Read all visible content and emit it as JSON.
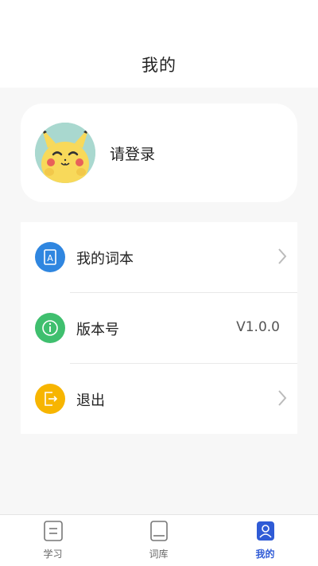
{
  "header": {
    "title": "我的"
  },
  "profile": {
    "login_label": "请登录",
    "avatar_icon": "pikachu-avatar"
  },
  "menu": {
    "items": [
      {
        "label": "我的词本",
        "icon": "vocabulary-book-icon",
        "icon_color": "#2f86e0"
      },
      {
        "label": "版本号",
        "value": "V1.0.0",
        "icon": "info-icon",
        "icon_color": "#3fbf6e"
      },
      {
        "label": "退出",
        "icon": "logout-icon",
        "icon_color": "#f7b500"
      }
    ]
  },
  "tabbar": {
    "tabs": [
      {
        "label": "学习",
        "icon": "study-icon"
      },
      {
        "label": "词库",
        "icon": "library-icon"
      },
      {
        "label": "我的",
        "icon": "profile-icon",
        "active": true
      }
    ],
    "active_color": "#2f5bd6"
  }
}
